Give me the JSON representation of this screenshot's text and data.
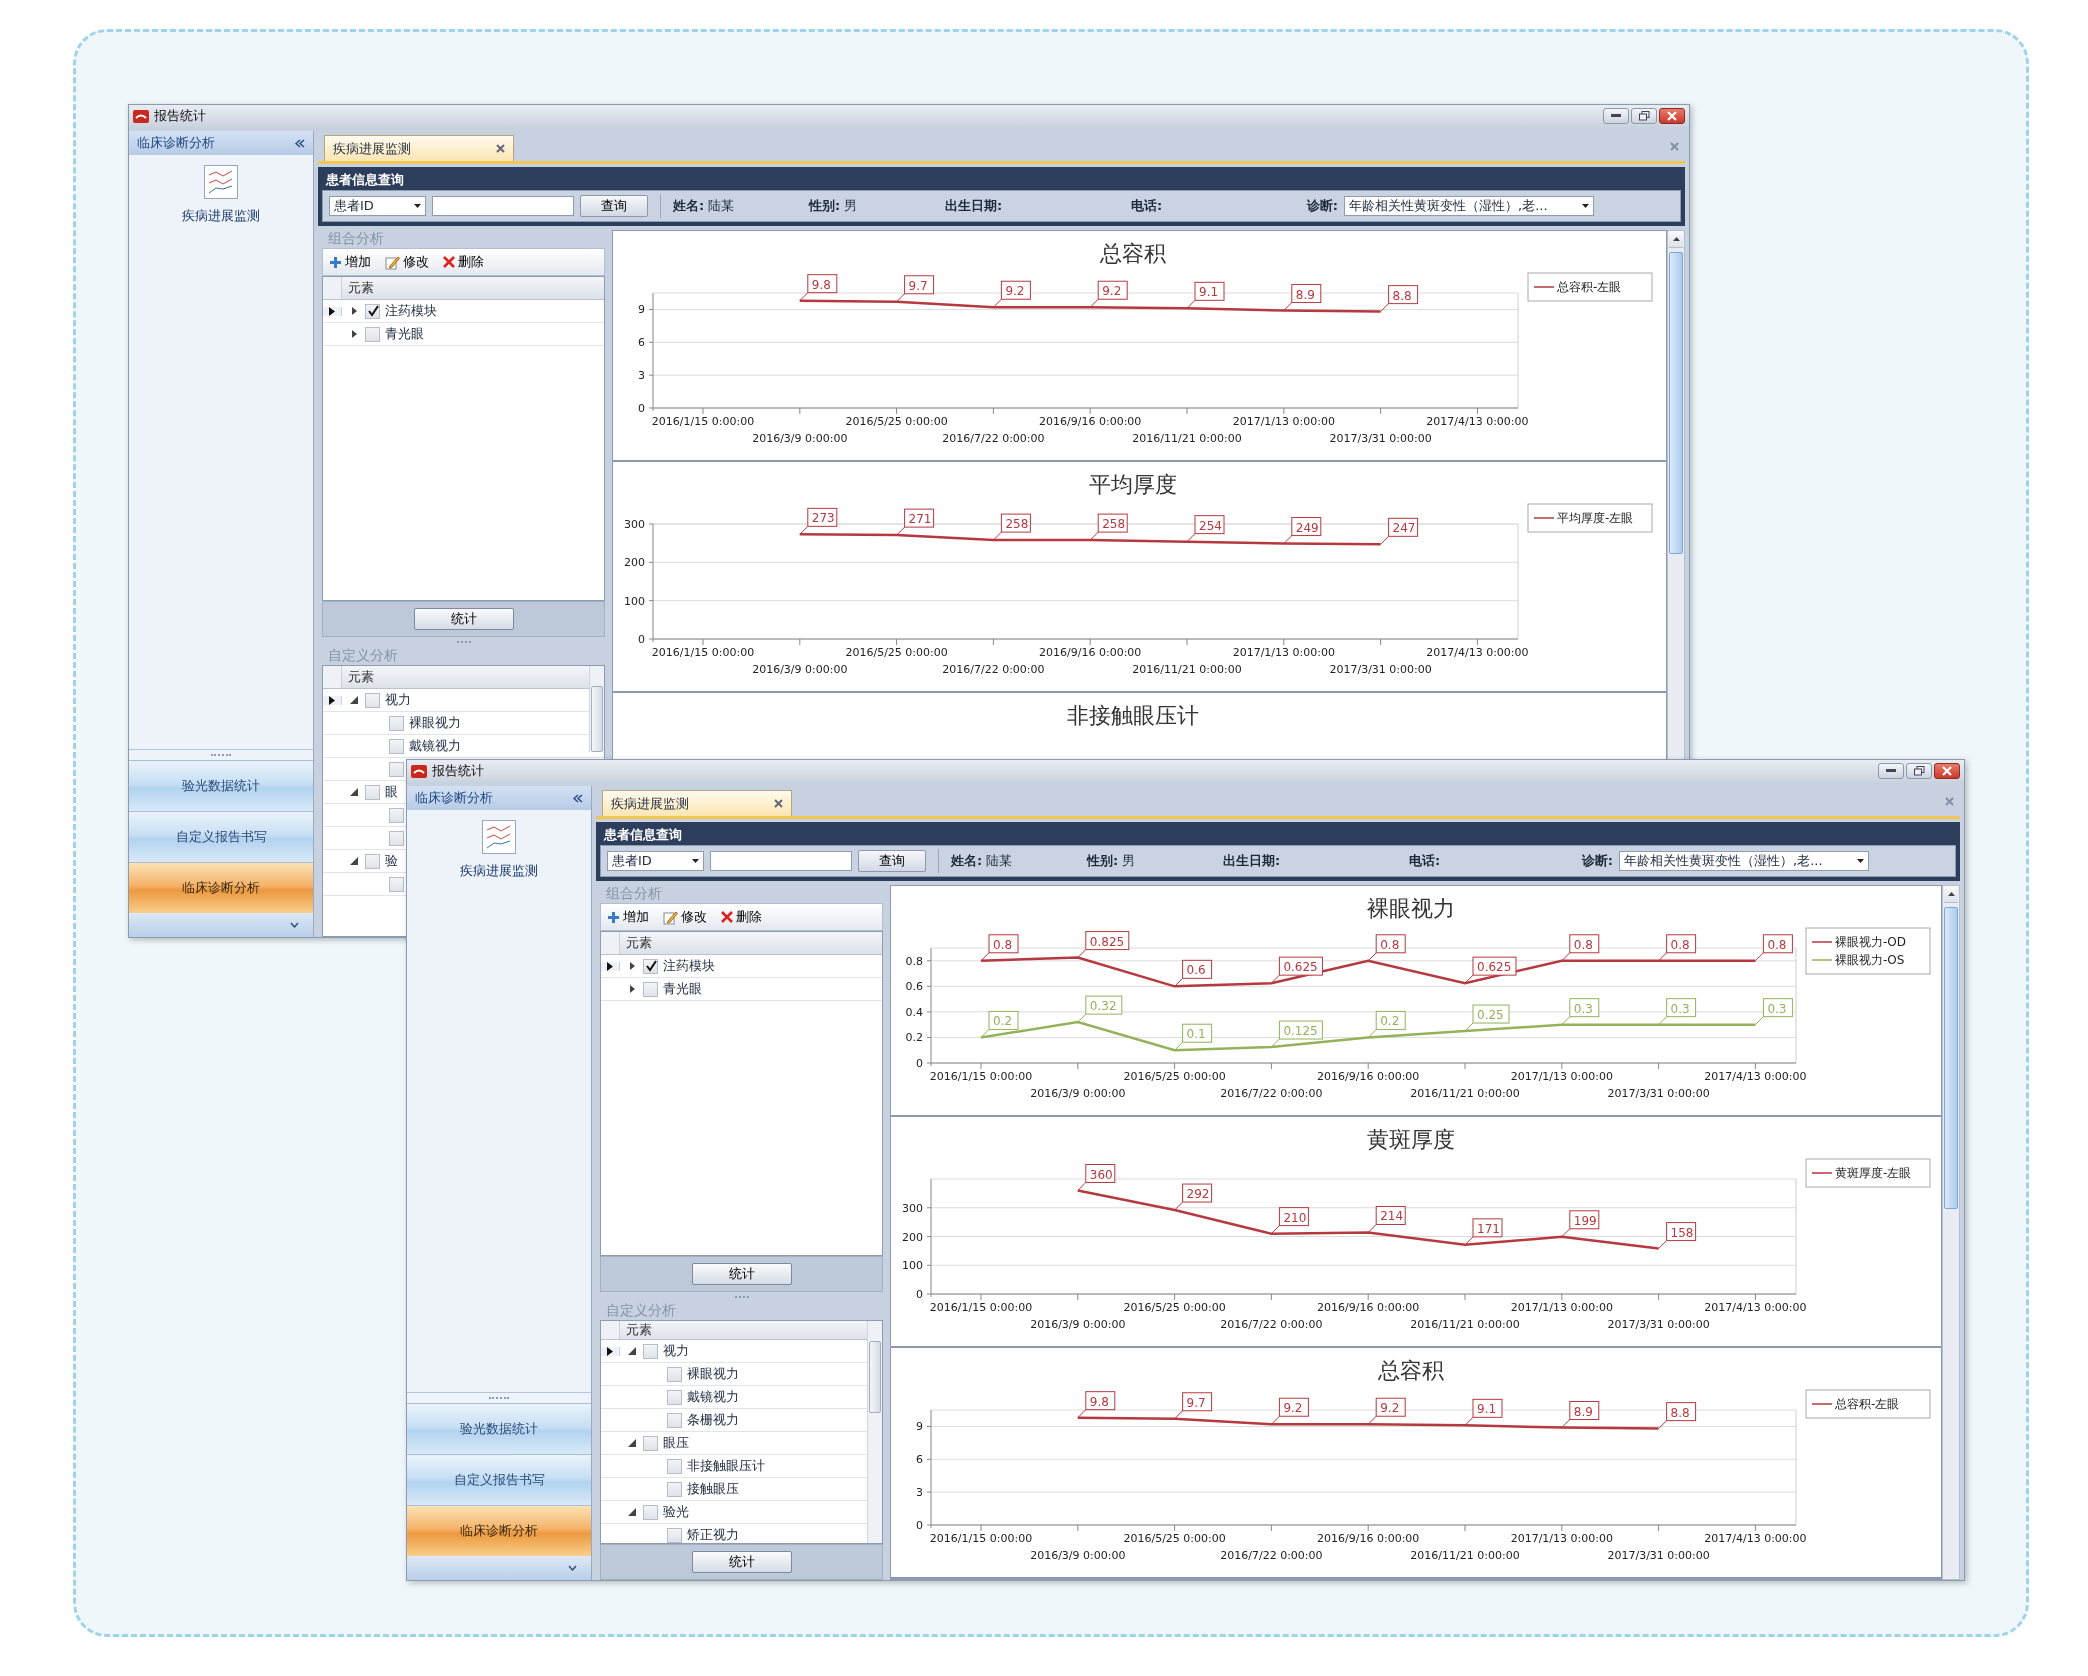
{
  "windows": [
    {
      "title": "报告统计",
      "nav": {
        "header": "临床诊断分析",
        "items": [
          {
            "label": "疾病进展监测"
          }
        ],
        "buttons": [
          {
            "label": "验光数据统计",
            "selected": false
          },
          {
            "label": "自定义报告书写",
            "selected": false
          },
          {
            "label": "临床诊断分析",
            "selected": true
          }
        ]
      },
      "tab": {
        "label": "疾病进展监测",
        "selected": true
      },
      "query": {
        "title": "患者信息查询",
        "id_field": "患者ID",
        "search_button": "查询",
        "fields": [
          {
            "label": "姓名:",
            "value": "陆某"
          },
          {
            "label": "性别:",
            "value": "男"
          },
          {
            "label": "出生日期:"
          },
          {
            "label": "电话:"
          }
        ],
        "diagnosis": {
          "label": "诊断:",
          "value": "年龄相关性黄斑变性（湿性）,老..."
        }
      },
      "combo": {
        "title": "组合分析",
        "toolbar": [
          {
            "label": "增加",
            "kind": "add"
          },
          {
            "label": "修改",
            "kind": "edit"
          },
          {
            "label": "删除",
            "kind": "delete"
          }
        ],
        "column": "元素",
        "rows": [
          {
            "label": "注药模块",
            "checked": true,
            "expanded": false,
            "selected": true
          },
          {
            "label": "青光眼",
            "checked": false,
            "expanded": false,
            "selected": false
          }
        ],
        "button": "统计"
      },
      "custom": {
        "title": "自定义分析",
        "column": "元素",
        "rows": [
          {
            "label": "视力",
            "checked": false,
            "expanded": true,
            "selected": true,
            "children": [
              {
                "label": "裸眼视力",
                "checked": false,
                "selected": false
              },
              {
                "label": "戴镜视力",
                "checked": false,
                "selected": false
              },
              {
                "checked": false,
                "selected": false
              }
            ]
          },
          {
            "label": "眼",
            "checked": false,
            "expanded": true,
            "selected": false,
            "children": [
              {
                "checked": false,
                "selected": false
              },
              {
                "checked": false,
                "selected": false
              }
            ]
          },
          {
            "label": "验",
            "checked": false,
            "expanded": true,
            "selected": false,
            "children": [
              {
                "checked": false,
                "selected": false
              }
            ]
          }
        ]
      },
      "charts": [
        {
          "chart_data": {
            "type": "line",
            "title": "总容积",
            "categories": [
              "2016/1/15 0:00:00",
              "2016/3/9 0:00:00",
              "2016/5/25 0:00:00",
              "2016/7/22 0:00:00",
              "2016/9/16 0:00:00",
              "2016/11/21 0:00:00",
              "2017/1/13 0:00:00",
              "2017/3/31 0:00:00",
              "2017/4/13 0:00:00"
            ],
            "series": [
              {
                "name": "总容积-左眼",
                "color": "#b5393f",
                "values": [
                  null,
                  9.8,
                  9.7,
                  9.2,
                  9.2,
                  9.1,
                  8.9,
                  8.8,
                  null
                ]
              }
            ],
            "ylim": [
              0,
              10.5
            ],
            "yticks": [
              0,
              3,
              6,
              9
            ],
            "grid": true,
            "legend": "right",
            "data_labels": true
          }
        },
        {
          "chart_data": {
            "type": "line",
            "title": "平均厚度",
            "categories": [
              "2016/1/15 0:00:00",
              "2016/3/9 0:00:00",
              "2016/5/25 0:00:00",
              "2016/7/22 0:00:00",
              "2016/9/16 0:00:00",
              "2016/11/21 0:00:00",
              "2017/1/13 0:00:00",
              "2017/3/31 0:00:00",
              "2017/4/13 0:00:00"
            ],
            "series": [
              {
                "name": "平均厚度-左眼",
                "color": "#b5393f",
                "values": [
                  null,
                  273,
                  271,
                  258,
                  258,
                  254,
                  249,
                  247,
                  null
                ]
              }
            ],
            "ylim": [
              0,
              300
            ],
            "yticks": [
              0,
              100,
              200,
              300
            ],
            "grid": true,
            "legend": "right",
            "data_labels": true
          }
        },
        {
          "title": "非接触眼压计"
        }
      ]
    },
    {
      "title": "报告统计",
      "nav": {
        "header": "临床诊断分析",
        "items": [
          {
            "label": "疾病进展监测"
          }
        ],
        "buttons": [
          {
            "label": "验光数据统计",
            "selected": false
          },
          {
            "label": "自定义报告书写",
            "selected": false
          },
          {
            "label": "临床诊断分析",
            "selected": true
          }
        ]
      },
      "tab": {
        "label": "疾病进展监测",
        "selected": true
      },
      "query": {
        "title": "患者信息查询",
        "id_field": "患者ID",
        "search_button": "查询",
        "fields": [
          {
            "label": "姓名:",
            "value": "陆某"
          },
          {
            "label": "性别:",
            "value": "男"
          },
          {
            "label": "出生日期:"
          },
          {
            "label": "电话:"
          }
        ],
        "diagnosis": {
          "label": "诊断:",
          "value": "年龄相关性黄斑变性（湿性）,老..."
        }
      },
      "combo": {
        "title": "组合分析",
        "toolbar": [
          {
            "label": "增加",
            "kind": "add"
          },
          {
            "label": "修改",
            "kind": "edit"
          },
          {
            "label": "删除",
            "kind": "delete"
          }
        ],
        "column": "元素",
        "rows": [
          {
            "label": "注药模块",
            "checked": true,
            "expanded": false,
            "selected": true
          },
          {
            "label": "青光眼",
            "checked": false,
            "expanded": false,
            "selected": false
          }
        ],
        "button": "统计"
      },
      "custom": {
        "title": "自定义分析",
        "column": "元素",
        "rows": [
          {
            "label": "视力",
            "checked": false,
            "expanded": true,
            "selected": true,
            "children": [
              {
                "label": "裸眼视力",
                "checked": false,
                "selected": false
              },
              {
                "label": "戴镜视力",
                "checked": false,
                "selected": false
              },
              {
                "label": "条栅视力",
                "checked": false,
                "selected": false
              }
            ]
          },
          {
            "label": "眼压",
            "checked": false,
            "expanded": true,
            "selected": false,
            "children": [
              {
                "label": "非接触眼压计",
                "checked": false,
                "selected": false
              },
              {
                "label": "接触眼压",
                "checked": false,
                "selected": false
              }
            ]
          },
          {
            "label": "验光",
            "checked": false,
            "expanded": true,
            "selected": false,
            "children": [
              {
                "label": "矫正视力",
                "checked": false,
                "selected": false
              }
            ]
          }
        ],
        "button": "统计"
      },
      "charts": [
        {
          "chart_data": {
            "type": "line",
            "title": "裸眼视力",
            "categories": [
              "2016/1/15 0:00:00",
              "2016/3/9 0:00:00",
              "2016/5/25 0:00:00",
              "2016/7/22 0:00:00",
              "2016/9/16 0:00:00",
              "2016/11/21 0:00:00",
              "2017/1/13 0:00:00",
              "2017/3/31 0:00:00",
              "2017/4/13 0:00:00"
            ],
            "series": [
              {
                "name": "裸眼视力-OD",
                "color": "#b5393f",
                "values": [
                  0.8,
                  0.825,
                  0.6,
                  0.625,
                  0.8,
                  0.625,
                  0.8,
                  0.8,
                  0.8
                ]
              },
              {
                "name": "裸眼视力-OS",
                "color": "#93b25a",
                "values": [
                  0.2,
                  0.32,
                  0.1,
                  0.125,
                  0.2,
                  0.25,
                  0.3,
                  0.3,
                  0.3
                ]
              }
            ],
            "ylim": [
              0,
              0.9
            ],
            "yticks": [
              0,
              0.2,
              0.4,
              0.6,
              0.8
            ],
            "grid": true,
            "legend": "right",
            "data_labels": true
          }
        },
        {
          "chart_data": {
            "type": "line",
            "title": "黄斑厚度",
            "categories": [
              "2016/1/15 0:00:00",
              "2016/3/9 0:00:00",
              "2016/5/25 0:00:00",
              "2016/7/22 0:00:00",
              "2016/9/16 0:00:00",
              "2016/11/21 0:00:00",
              "2017/1/13 0:00:00",
              "2017/3/31 0:00:00",
              "2017/4/13 0:00:00"
            ],
            "series": [
              {
                "name": "黄斑厚度-左眼",
                "color": "#b5393f",
                "values": [
                  null,
                  360,
                  292,
                  210,
                  214,
                  171,
                  199,
                  158,
                  null
                ]
              }
            ],
            "ylim": [
              0,
              400
            ],
            "yticks": [
              0,
              100,
              200,
              300
            ],
            "grid": true,
            "legend": "right",
            "data_labels": true
          }
        },
        {
          "chart_data": {
            "type": "line",
            "title": "总容积",
            "categories": [
              "2016/1/15 0:00:00",
              "2016/3/9 0:00:00",
              "2016/5/25 0:00:00",
              "2016/7/22 0:00:00",
              "2016/9/16 0:00:00",
              "2016/11/21 0:00:00",
              "2017/1/13 0:00:00",
              "2017/3/31 0:00:00",
              "2017/4/13 0:00:00"
            ],
            "series": [
              {
                "name": "总容积-左眼",
                "color": "#b5393f",
                "values": [
                  null,
                  9.8,
                  9.7,
                  9.2,
                  9.2,
                  9.1,
                  8.9,
                  8.8,
                  null
                ]
              }
            ],
            "ylim": [
              0,
              10.5
            ],
            "yticks": [
              0,
              3,
              6,
              9
            ],
            "grid": true,
            "legend": "right",
            "data_labels": true
          }
        }
      ]
    }
  ]
}
